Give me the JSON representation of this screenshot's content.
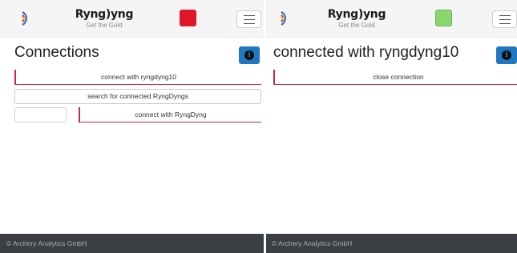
{
  "colors": {
    "accent": "#c8284e",
    "info_button": "#1f78c1",
    "status_disconnected": "#e0162b",
    "status_connected": "#8bd56f",
    "footer": "#3b3f44"
  },
  "left_screen": {
    "header": {
      "logo_icon": "ryngdyng-target-icon",
      "brand": "Ryng)yng",
      "tagline": "Get the Gold",
      "status_color": "#e0162b",
      "menu_icon": "hamburger-menu-icon"
    },
    "title": "Connections",
    "info_icon": "info-icon",
    "connect_known_label": "connect with ryngdyng10",
    "search_label": "search for connected RyngDyngs",
    "id_input_value": "",
    "connect_label": "connect with RyngDyng",
    "footer": "© Archery Analytics GmbH"
  },
  "right_screen": {
    "header": {
      "logo_icon": "ryngdyng-target-icon",
      "brand": "Ryng)yng",
      "tagline": "Get the Gold",
      "status_color": "#8bd56f",
      "menu_icon": "hamburger-menu-icon"
    },
    "title": "connected with ryngdyng10",
    "info_icon": "info-icon",
    "close_label": "close connection",
    "footer": "© Archery Analytics GmbH"
  }
}
